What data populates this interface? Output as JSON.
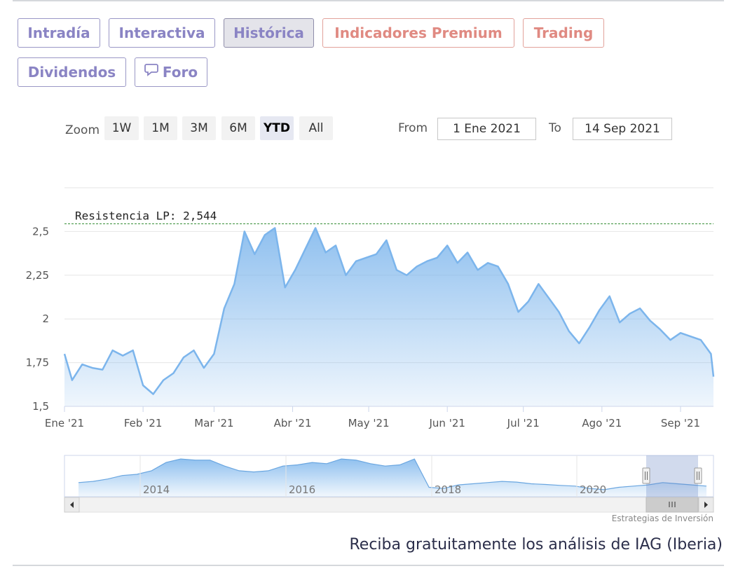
{
  "tabs": [
    {
      "label": "Intradía",
      "style": "normal"
    },
    {
      "label": "Interactiva",
      "style": "normal"
    },
    {
      "label": "Histórica",
      "style": "active"
    },
    {
      "label": "Indicadores Premium",
      "style": "premium"
    },
    {
      "label": "Trading",
      "style": "premium"
    },
    {
      "label": "Dividendos",
      "style": "normal"
    },
    {
      "label": "Foro",
      "style": "normal",
      "icon": "chat-bubble-icon"
    }
  ],
  "zoom": {
    "label": "Zoom",
    "buttons": [
      "1W",
      "1M",
      "3M",
      "6M",
      "YTD",
      "All"
    ],
    "selected": "YTD"
  },
  "range": {
    "from_label": "From",
    "from_value": "1 Ene 2021",
    "to_label": "To",
    "to_value": "14 Sep 2021"
  },
  "credit": "Estrategias de Inversión",
  "promo": "Reciba gratuitamente los análisis de IAG (Iberia)",
  "colors": {
    "line": "#7cb5ec",
    "resistance": "#2e8b2e",
    "accent": "#8a84c4",
    "premium": "#e08a82"
  },
  "chart_data": {
    "type": "area",
    "x_labels": [
      "Ene '21",
      "Feb '21",
      "Mar '21",
      "Abr '21",
      "May '21",
      "Jun '21",
      "Jul '21",
      "Ago '21",
      "Sep '21"
    ],
    "y_ticks": [
      "1,5",
      "1,75",
      "2",
      "2,25",
      "2,5"
    ],
    "ylim": [
      1.5,
      2.75
    ],
    "resistance": {
      "label": "Resistencia LP: 2,544",
      "value": 2.544
    },
    "series": [
      {
        "x": [
          "2021-01-01",
          "2021-01-04",
          "2021-01-08",
          "2021-01-12",
          "2021-01-16",
          "2021-01-20",
          "2021-01-24",
          "2021-01-28",
          "2021-02-01",
          "2021-02-05",
          "2021-02-09",
          "2021-02-13",
          "2021-02-17",
          "2021-02-21",
          "2021-02-25",
          "2021-03-01",
          "2021-03-05",
          "2021-03-09",
          "2021-03-13",
          "2021-03-17",
          "2021-03-21",
          "2021-03-25",
          "2021-03-29",
          "2021-04-02",
          "2021-04-06",
          "2021-04-10",
          "2021-04-14",
          "2021-04-18",
          "2021-04-22",
          "2021-04-26",
          "2021-04-30",
          "2021-05-04",
          "2021-05-08",
          "2021-05-12",
          "2021-05-16",
          "2021-05-20",
          "2021-05-24",
          "2021-05-28",
          "2021-06-01",
          "2021-06-05",
          "2021-06-09",
          "2021-06-13",
          "2021-06-17",
          "2021-06-21",
          "2021-06-25",
          "2021-06-29",
          "2021-07-03",
          "2021-07-07",
          "2021-07-11",
          "2021-07-15",
          "2021-07-19",
          "2021-07-23",
          "2021-07-27",
          "2021-07-31",
          "2021-08-04",
          "2021-08-08",
          "2021-08-12",
          "2021-08-16",
          "2021-08-20",
          "2021-08-24",
          "2021-08-28",
          "2021-09-01",
          "2021-09-05",
          "2021-09-09",
          "2021-09-13",
          "2021-09-14"
        ],
        "y": [
          1.8,
          1.65,
          1.74,
          1.72,
          1.71,
          1.82,
          1.79,
          1.82,
          1.62,
          1.57,
          1.65,
          1.69,
          1.78,
          1.82,
          1.72,
          1.8,
          2.06,
          2.2,
          2.5,
          2.37,
          2.48,
          2.52,
          2.18,
          2.28,
          2.4,
          2.52,
          2.38,
          2.42,
          2.25,
          2.33,
          2.35,
          2.37,
          2.45,
          2.28,
          2.25,
          2.3,
          2.33,
          2.35,
          2.42,
          2.32,
          2.38,
          2.28,
          2.32,
          2.3,
          2.2,
          2.04,
          2.1,
          2.2,
          2.12,
          2.04,
          1.93,
          1.86,
          1.95,
          2.05,
          2.13,
          1.98,
          2.03,
          2.06,
          1.99,
          1.94,
          1.88,
          1.92,
          1.9,
          1.88,
          1.8,
          1.67
        ]
      }
    ],
    "navigator": {
      "x_labels": [
        "2014",
        "2016",
        "2018",
        "2020"
      ],
      "values": [
        1.6,
        1.65,
        1.75,
        1.9,
        1.95,
        2.1,
        2.45,
        2.6,
        2.55,
        2.55,
        2.3,
        2.1,
        2.05,
        2.1,
        2.3,
        2.35,
        2.45,
        2.4,
        2.6,
        2.55,
        2.4,
        2.3,
        2.35,
        2.6,
        1.4,
        1.35,
        1.5,
        1.55,
        1.6,
        1.65,
        1.62,
        1.55,
        1.52,
        1.48,
        1.45,
        1.35,
        1.3,
        1.4,
        1.45,
        1.5,
        1.6,
        1.55,
        1.5,
        1.45
      ]
    }
  }
}
